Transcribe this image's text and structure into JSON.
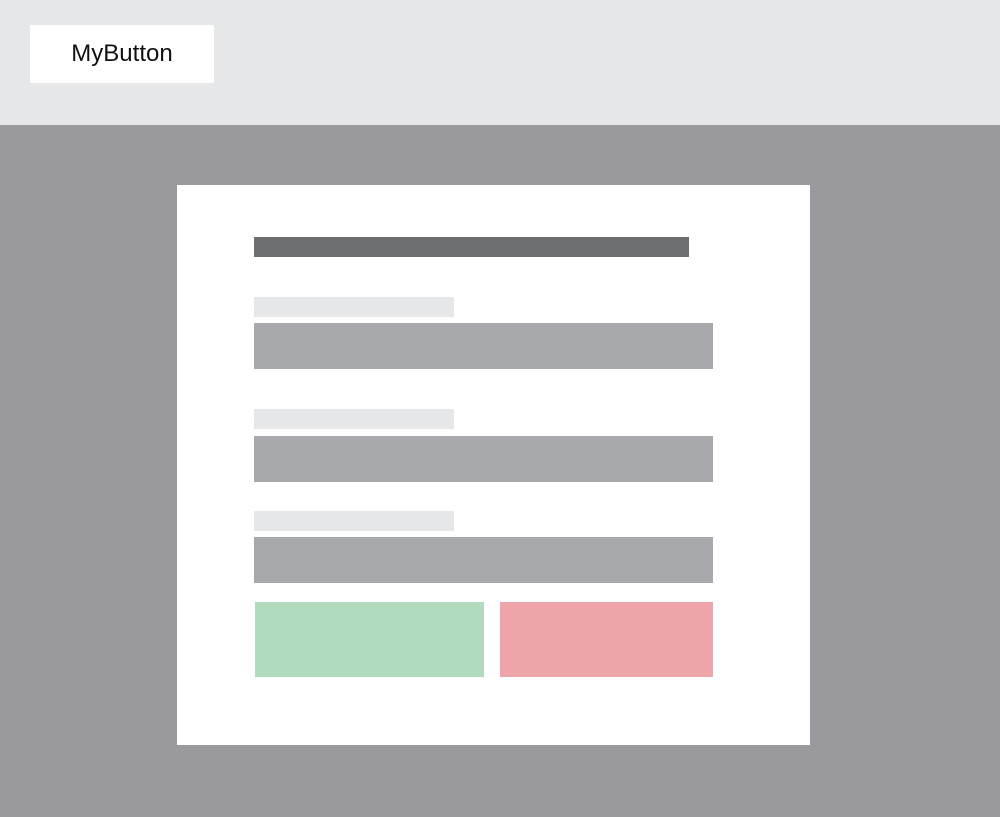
{
  "toolbar": {
    "button_label": "MyButton"
  },
  "colors": {
    "background": "#9a9a9e",
    "topbar": "#e6e7e8",
    "dialog": "#ffffff",
    "title_bar": "#6d6e71",
    "label_placeholder": "#e6e7e8",
    "input_placeholder": "#a7a9ac",
    "confirm": "#b1dbbf",
    "cancel": "#eea5aa"
  }
}
